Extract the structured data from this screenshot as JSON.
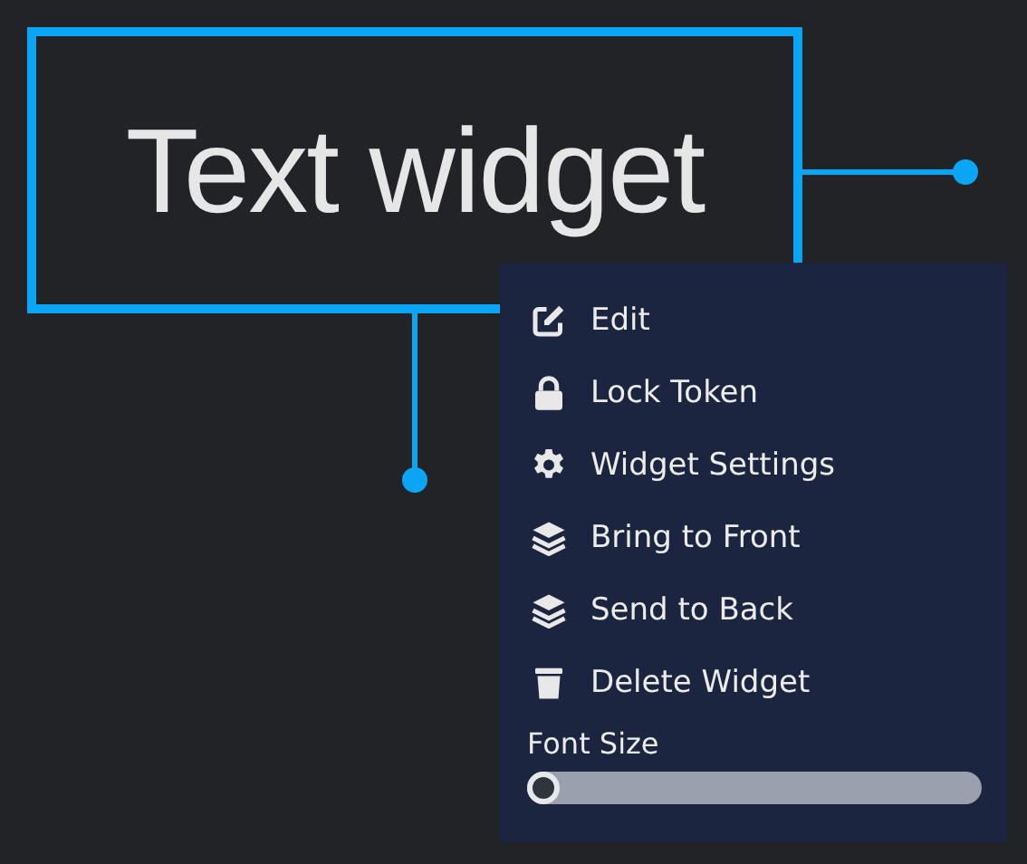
{
  "widget": {
    "text": "Text widget"
  },
  "menu": {
    "items": [
      {
        "label": "Edit",
        "kind": "edit"
      },
      {
        "label": "Lock Token",
        "kind": "lock"
      },
      {
        "label": "Widget Settings",
        "kind": "gear"
      },
      {
        "label": "Bring to Front",
        "kind": "layers"
      },
      {
        "label": "Send to Back",
        "kind": "layers"
      },
      {
        "label": "Delete Widget",
        "kind": "trash"
      }
    ],
    "font_size": {
      "label": "Font Size",
      "level": 0
    }
  }
}
